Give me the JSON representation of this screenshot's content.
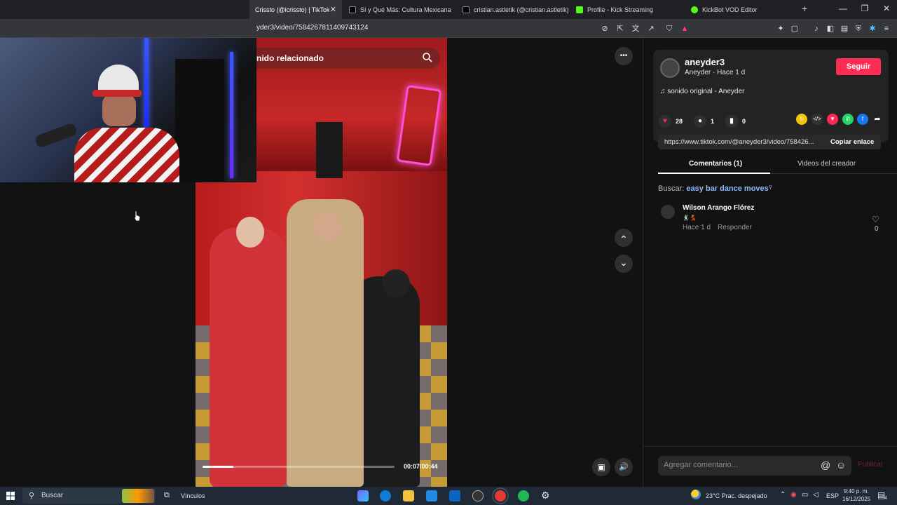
{
  "browser": {
    "tabs": [
      {
        "label": "Crissto (@icrissto) | TikTok",
        "color": "#000000",
        "active": true
      },
      {
        "label": "Sí y Qué Más: Cultura Mexicana y Co",
        "color": "#000000"
      },
      {
        "label": "cristian.astletik (@cristian.astletik) | T",
        "color": "#000000"
      },
      {
        "label": "Profile - Kick Streaming",
        "color": "#53fc18"
      },
      {
        "label": "KickBot VOD Editor",
        "color": "#53fc18"
      }
    ],
    "tab_close": "✕",
    "new_tab": "+",
    "window_controls": {
      "minimize": "—",
      "restore": "❐",
      "close": "✕"
    },
    "url": "yder3/video/7584267811409743124"
  },
  "video": {
    "search_text": "nido relacionado",
    "time": "00:07/00:44",
    "progress": 0.16,
    "more_glyph": "•••",
    "up_glyph": "⌃",
    "down_glyph": "⌄",
    "volume_glyph": "🔊",
    "pip_glyph": "▣"
  },
  "panel": {
    "username": "aneyder3",
    "subline": "Aneyder · Hace 1 d",
    "follow_label": "Seguir",
    "music": "♫  sonido original - Aneyder",
    "likes": "28",
    "comments": "1",
    "saves": "0",
    "link": "https://www.tiktok.com/@aneyder3/video/758426...",
    "copy_label": "Copiar enlace",
    "tab_comments": "Comentarios (1)",
    "tab_creator": "Videos del creador",
    "search_prefix": "Buscar: ",
    "search_query": "easy bar dance moves",
    "comment": {
      "name": "Wilson Arango Flórez",
      "emoji": "🕺💃",
      "time": "Hace 1 d",
      "reply": "Responder",
      "likes": "0"
    },
    "compose_placeholder": "Agregar comentario...",
    "at_glyph": "@",
    "emoji_glyph": "☺",
    "publish_label": "Publicar"
  },
  "taskbar": {
    "search_label": "Buscar",
    "vinculos": "Vínculos",
    "weather": "23°C  Prac. despejado",
    "lang": "ESP",
    "time": "9:40 p. m.",
    "date": "16/12/2025",
    "notif": "4"
  },
  "colors": {
    "follow": "#fe2c55",
    "like": "#fe2c55",
    "query": "#8fb9ff"
  }
}
